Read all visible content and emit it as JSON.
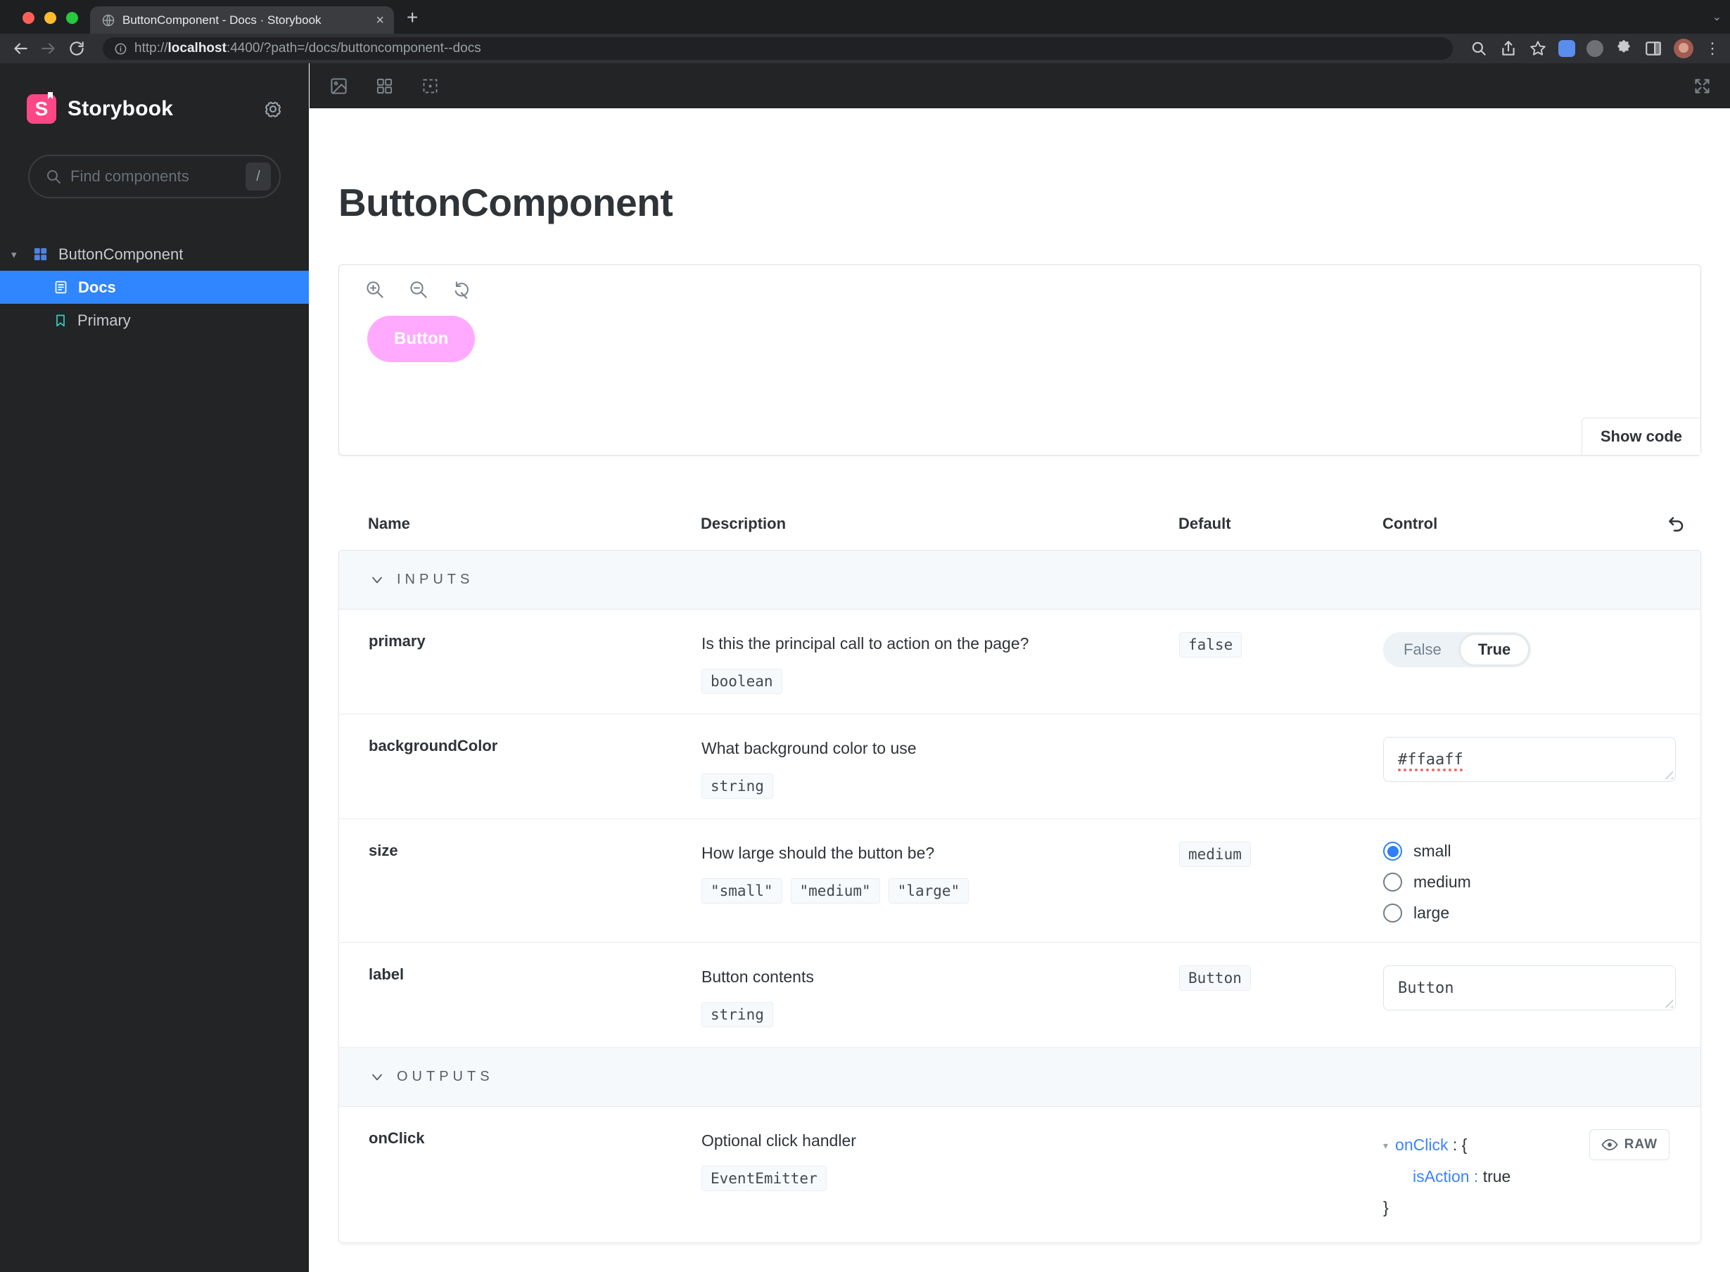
{
  "browser": {
    "tab_title": "ButtonComponent - Docs · Storybook",
    "new_tab_label": "+",
    "url_scheme": "http://",
    "url_host": "localhost",
    "url_rest": ":4400/?path=/docs/buttoncomponent--docs"
  },
  "sidebar": {
    "brand": "Storybook",
    "logo_letter": "S",
    "search_placeholder": "Find components",
    "search_shortcut": "/",
    "tree": {
      "component": "ButtonComponent",
      "docs": "Docs",
      "primary": "Primary"
    }
  },
  "page": {
    "title": "ButtonComponent",
    "preview_button_label": "Button",
    "show_code_label": "Show code"
  },
  "args_table": {
    "columns": [
      "Name",
      "Description",
      "Default",
      "Control"
    ],
    "inputs_label": "INPUTS",
    "outputs_label": "OUTPUTS",
    "inputs": [
      {
        "name": "primary",
        "description": "Is this the principal call to action on the page?",
        "type": "boolean",
        "default": "false",
        "control": {
          "false_label": "False",
          "true_label": "True",
          "selected": "True"
        }
      },
      {
        "name": "backgroundColor",
        "description": "What background color to use",
        "type": "string",
        "control": {
          "value": "#ffaaff"
        }
      },
      {
        "name": "size",
        "description": "How large should the button be?",
        "types": [
          "\"small\"",
          "\"medium\"",
          "\"large\""
        ],
        "default": "medium",
        "control": {
          "options": [
            "small",
            "medium",
            "large"
          ],
          "selected": "small"
        }
      },
      {
        "name": "label",
        "description": "Button contents",
        "type": "string",
        "default": "Button",
        "control": {
          "value": "Button"
        }
      }
    ],
    "outputs": [
      {
        "name": "onClick",
        "description": "Optional click handler",
        "type": "EventEmitter",
        "control": {
          "key": "onClick",
          "open": " : {",
          "subkey": "isAction :",
          "subvalue": "true",
          "close": "}",
          "raw_label": "RAW"
        }
      }
    ]
  },
  "colors": {
    "accent_blue": "#2f86ff",
    "brand_pink": "#ff4785",
    "preview_button_bg": "#ffaaff",
    "bookmark_teal": "#35d0c5",
    "sidebar_bg": "#222425"
  }
}
